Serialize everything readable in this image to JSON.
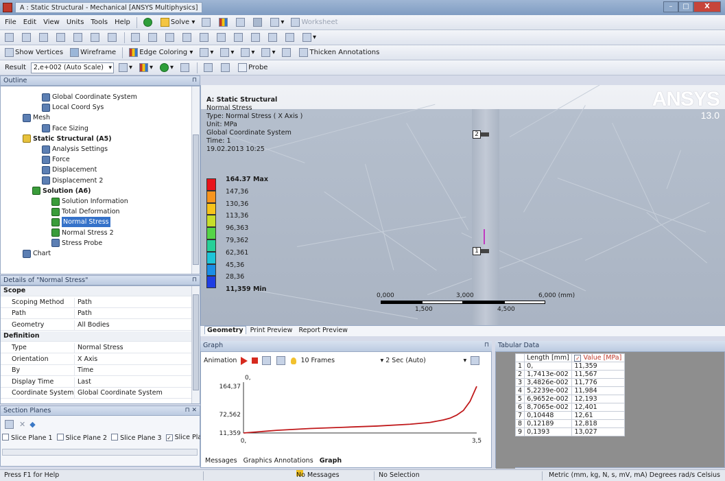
{
  "window": {
    "title": "A : Static Structural - Mechanical [ANSYS Multiphysics]",
    "controls": [
      "–",
      "□",
      "X"
    ]
  },
  "menu": [
    "File",
    "Edit",
    "View",
    "Units",
    "Tools",
    "Help"
  ],
  "toolbar1": {
    "solve": "Solve",
    "worksheet": "Worksheet"
  },
  "toolbar3": {
    "show_vertices": "Show Vertices",
    "wireframe": "Wireframe",
    "edge_coloring": "Edge Coloring",
    "thicken": "Thicken Annotations"
  },
  "toolbar4": {
    "result_label": "Result",
    "scale": "2,e+002 (Auto Scale)",
    "probe": "Probe"
  },
  "outline": {
    "header": "Outline",
    "items": [
      {
        "label": "Global Coordinate System",
        "indent": 4,
        "icon": "coord"
      },
      {
        "label": "Local Coord Sys",
        "indent": 4,
        "icon": "coord"
      },
      {
        "label": "Mesh",
        "indent": 2,
        "icon": "mesh"
      },
      {
        "label": "Face Sizing",
        "indent": 4,
        "icon": "sizing"
      },
      {
        "label": "Static Structural (A5)",
        "indent": 2,
        "icon": "static",
        "bold": true
      },
      {
        "label": "Analysis Settings",
        "indent": 4,
        "icon": "settings"
      },
      {
        "label": "Force",
        "indent": 4,
        "icon": "force"
      },
      {
        "label": "Displacement",
        "indent": 4,
        "icon": "displacement"
      },
      {
        "label": "Displacement 2",
        "indent": 4,
        "icon": "displacement"
      },
      {
        "label": "Solution (A6)",
        "indent": 3,
        "icon": "solution",
        "bold": true
      },
      {
        "label": "Solution Information",
        "indent": 5,
        "icon": "info"
      },
      {
        "label": "Total Deformation",
        "indent": 5,
        "icon": "result"
      },
      {
        "label": "Normal Stress",
        "indent": 5,
        "icon": "result",
        "selected": true
      },
      {
        "label": "Normal Stress 2",
        "indent": 5,
        "icon": "result"
      },
      {
        "label": "Stress Probe",
        "indent": 5,
        "icon": "probe"
      },
      {
        "label": "Chart",
        "indent": 2,
        "icon": "chart"
      }
    ]
  },
  "details": {
    "header": "Details of \"Normal Stress\"",
    "rows": [
      {
        "group": "Scope"
      },
      {
        "k": "Scoping Method",
        "v": "Path"
      },
      {
        "k": "Path",
        "v": "Path"
      },
      {
        "k": "Geometry",
        "v": "All Bodies"
      },
      {
        "group": "Definition"
      },
      {
        "k": "Type",
        "v": "Normal Stress"
      },
      {
        "k": "Orientation",
        "v": "X Axis"
      },
      {
        "k": "By",
        "v": "Time"
      },
      {
        "k": "Display Time",
        "v": "Last"
      },
      {
        "k": "Coordinate System",
        "v": "Global Coordinate System"
      }
    ]
  },
  "section_planes": {
    "header": "Section Planes",
    "slices": [
      {
        "label": "Slice Plane 1",
        "checked": false
      },
      {
        "label": "Slice Plane 2",
        "checked": false
      },
      {
        "label": "Slice Plane 3",
        "checked": false
      },
      {
        "label": "Slice Plan",
        "checked": true
      }
    ]
  },
  "viewport": {
    "info": {
      "title": "A: Static Structural",
      "result": "Normal Stress",
      "type": "Type: Normal Stress ( X Axis )",
      "unit": "Unit: MPa",
      "coord": "Global Coordinate System",
      "time": "Time: 1",
      "date": "19.02.2013 10:25"
    },
    "legend": [
      {
        "label": "164.37 Max",
        "color": "#e8141c",
        "bold": true
      },
      {
        "label": "147,36",
        "color": "#f7941d"
      },
      {
        "label": "130,36",
        "color": "#f6c31b"
      },
      {
        "label": "113,36",
        "color": "#c7dd2a"
      },
      {
        "label": "96,363",
        "color": "#55d447"
      },
      {
        "label": "79,362",
        "color": "#27cf98"
      },
      {
        "label": "62,361",
        "color": "#1dc4d8"
      },
      {
        "label": "45,36",
        "color": "#1a8ee6"
      },
      {
        "label": "28,36",
        "color": "#1f3ee3"
      },
      {
        "label": "11,359 Min",
        "color": "#1f3ee3",
        "bold": true
      }
    ],
    "brand": "ANSYS",
    "version": "13.0",
    "probes": [
      "2",
      "1"
    ],
    "scale": {
      "top": [
        "0,000",
        "3,000",
        "6,000 (mm)"
      ],
      "bottom": [
        "1,500",
        "4,500"
      ]
    }
  },
  "view_tabs": [
    "Geometry",
    "Print Preview",
    "Report Preview"
  ],
  "graph": {
    "header": "Graph",
    "animation": "Animation",
    "frames": "10 Frames",
    "duration": "2 Sec (Auto)",
    "tabs": [
      "Messages",
      "Graphics Annotations",
      "Graph"
    ]
  },
  "chart_data": {
    "type": "line",
    "title": "",
    "xlabel": "",
    "ylabel": "",
    "ylim": [
      11.359,
      164.37
    ],
    "xlim": [
      0,
      3.5
    ],
    "y_ticks": [
      "164,37",
      "72,562",
      "11,359"
    ],
    "x_ticks": [
      "0,",
      "3,5"
    ],
    "top_label": "0,",
    "series": [
      {
        "color": "#c0191b",
        "x": [
          0,
          0.5,
          1.0,
          1.5,
          2.0,
          2.5,
          2.8,
          3.0,
          3.1,
          3.2,
          3.3,
          3.4,
          3.5
        ],
        "y": [
          11.359,
          20,
          26,
          30,
          34,
          40,
          46,
          54,
          60,
          70,
          85,
          115,
          164.37
        ]
      }
    ]
  },
  "tabular": {
    "header": "Tabular Data",
    "col_length": "Length [mm]",
    "col_value": "Value [MPa]",
    "rows": [
      {
        "n": "1",
        "len": "0,",
        "val": "11,359"
      },
      {
        "n": "2",
        "len": "1,7413e-002",
        "val": "11,567"
      },
      {
        "n": "3",
        "len": "3,4826e-002",
        "val": "11,776"
      },
      {
        "n": "4",
        "len": "5,2239e-002",
        "val": "11,984"
      },
      {
        "n": "5",
        "len": "6,9652e-002",
        "val": "12,193"
      },
      {
        "n": "6",
        "len": "8,7065e-002",
        "val": "12,401"
      },
      {
        "n": "7",
        "len": "0,10448",
        "val": "12,61"
      },
      {
        "n": "8",
        "len": "0,12189",
        "val": "12,818"
      },
      {
        "n": "9",
        "len": "0,1393",
        "val": "13,027"
      }
    ]
  },
  "status": {
    "help": "Press F1 for Help",
    "messages": "No Messages",
    "selection": "No Selection",
    "units": "Metric (mm, kg, N, s, mV, mA)  Degrees  rad/s  Celsius"
  }
}
